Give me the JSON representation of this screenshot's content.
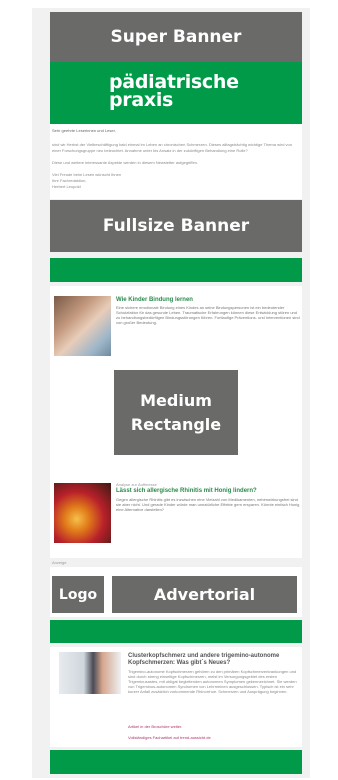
{
  "ads": {
    "super_banner": "Super Banner",
    "fullsize_banner": "Fullsize Banner",
    "medium_rectangle": "Medium Rectangle",
    "logo": "Logo",
    "advertorial": "Advertorial"
  },
  "header": {
    "logo_line1": "pädiatrische",
    "logo_line2": "praxis",
    "greeting": "Sehr geehrte Leserinnen und Leser,",
    "intro": "sind wir Herbst der Vielbeschäftigung bald einmal im Leben an chronischen Schmerzen. Dieses alltagsträchtig wichtige Thema wird von einer Forschungsgruppe neu beleuchtet. Annahme unter bis Ansatz in der zukünftigen Behandlung eine Rolle?",
    "intro2": "Diese und weitere interessante Aspekte werden in diesem Newsletter aufgegriffen.",
    "closing": "Viel Freude beim Lesen wünscht Ihnen",
    "team": "Ihre Fachredaktion,",
    "author": "Herbert Leupold"
  },
  "article1": {
    "title": "Wie Kinder Bindung lernen",
    "body": "Eine sichere emotionale Bindung eines Kindes an seine Bindungspersonen ist ein bedeutender Schutzfaktor für das gesunde Leben. Traumatische Erfahrungen können diese Entwicklung stören und zu behandlungsbedürftigen Bindungsstörungen führen. Fortlaufige Präventions- und Interventionen sind von großer Bedeutung."
  },
  "article2": {
    "kicker": "Analyse zur Äuffmesse",
    "title": "Lässt sich allergische Rhinitis mit Honig lindern?",
    "body": "Gegen allergische Rhinitis gibt es inzwischen eine Vielzahl von Medikamenten, nebenwirkungsfrei sind sie aber nicht. Und gerade Kinder würde man unnatürliche Effekte gern ersparen. Könnte einfach Honig eine Alternative darstellen?"
  },
  "anzeige": "Anzeige",
  "advertorial": {
    "title": "Clusterkopfschmerz und andere trigemino-autonome Kopfschmerzen: Was gibt´s Neues?",
    "body": "Trigemino-autonome Kopfschmerzen gehören zu den primären Kopfschmerzerkrankungen und sind durch streng einseitige Kopfschmerzen, meist im Versorgungsgebiet des ersten Trigeminusastes, mit obligat begleitenden autonomen Symptomen gekennzeichnet. Sie werden von Trigeminus-autonomen Syndromen von Lehrmeinen ausgeschlossen. Typisch ist ein sehr kurzer Anfall zusätzlich vorkommende Rhinorrhoe. Schmerzen und Ausprägung beginnen.",
    "link1": "Artikel in der Broschüre weiter.",
    "link2": "Vollständiges Fachartikel auf trend-aussicht.de"
  },
  "colors": {
    "ad_gray": "#6a6a69",
    "brand_green": "#009a48",
    "page_bg": "#f1f1f1"
  }
}
